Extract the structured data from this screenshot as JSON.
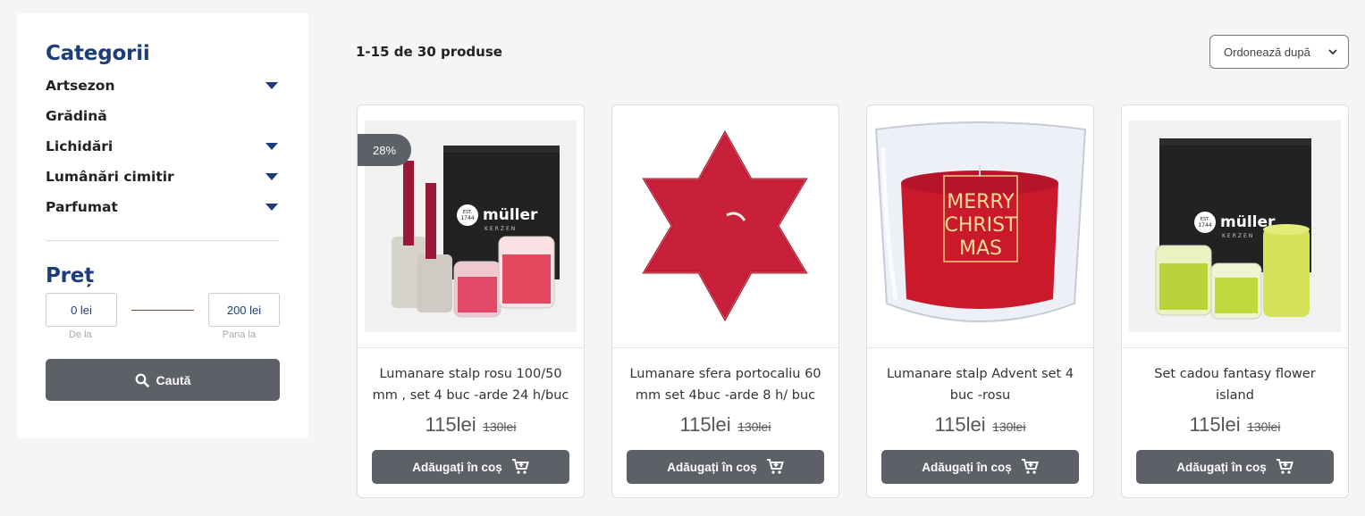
{
  "sidebar": {
    "categories_title": "Categorii",
    "categories": [
      {
        "label": "Artsezon",
        "expandable": true
      },
      {
        "label": "Grădină",
        "expandable": false
      },
      {
        "label": "Lichidări",
        "expandable": true
      },
      {
        "label": "Lumânări cimitir",
        "expandable": true
      },
      {
        "label": "Parfumat",
        "expandable": true
      }
    ],
    "price_title": "Preț",
    "price_min": "0 lei",
    "price_max": "200 lei",
    "price_min_label": "De la",
    "price_max_label": "Pana la",
    "search_label": "Caută"
  },
  "main": {
    "result_count": "1-15 de 30 produse",
    "sort_label": "Ordonează după"
  },
  "products": [
    {
      "title": "Lumanare stalp rosu 100/50 mm , set 4 buc -arde 24 h/buc",
      "price": "115lei",
      "old_price": "130lei",
      "badge": "28%",
      "add_label": "Adăugați în coș"
    },
    {
      "title": "Lumanare sfera portocaliu 60 mm set 4buc -arde 8 h/ buc",
      "price": "115lei",
      "old_price": "130lei",
      "add_label": "Adăugați în coș"
    },
    {
      "title": "Lumanare stalp Advent set 4 buc -rosu",
      "price": "115lei",
      "old_price": "130lei",
      "add_label": "Adăugați în coș"
    },
    {
      "title": "Set cadou fantasy flower island",
      "price": "115lei",
      "old_price": "130lei",
      "add_label": "Adăugați în coș"
    }
  ],
  "image_text": {
    "brand": "müller",
    "brand_sub": "KERZEN",
    "brand_seal": "1744",
    "candle_text_1": "MERRY",
    "candle_text_2": "CHRIST",
    "candle_text_3": "MAS"
  },
  "colors": {
    "accent": "#1d3c7a",
    "button": "#5e6068"
  }
}
